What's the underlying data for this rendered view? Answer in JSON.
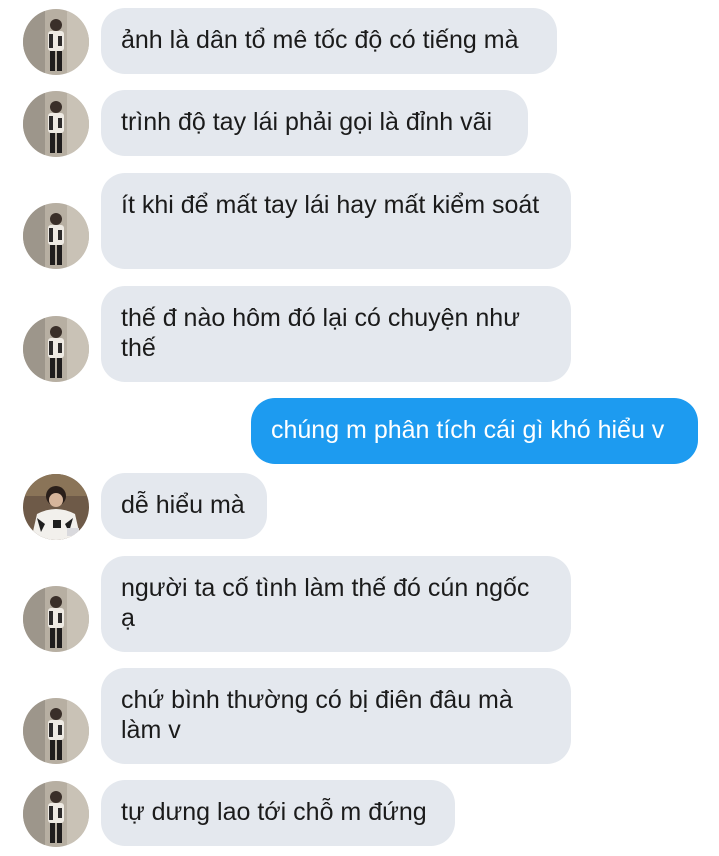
{
  "colors": {
    "incoming_bubble": "#e4e8ee",
    "outgoing_bubble": "#1d9bf0",
    "background": "#ffffff"
  },
  "messages": [
    {
      "sender": "other",
      "text": "ảnh là dân tổ mê tốc độ có tiếng mà"
    },
    {
      "sender": "other",
      "text": "trình độ tay lái phải gọi là đỉnh vãi"
    },
    {
      "sender": "other",
      "text": "ít khi để mất tay lái hay mất kiểm soát"
    },
    {
      "sender": "other",
      "text": "thế đ nào hôm đó lại có chuyện như thế"
    },
    {
      "sender": "me",
      "text": "chúng m phân tích cái gì khó hiểu v"
    },
    {
      "sender": "other2",
      "text": "dễ hiểu mà"
    },
    {
      "sender": "other",
      "text": "người ta cố tình làm thế đó cún ngốc ạ"
    },
    {
      "sender": "other",
      "text": "chứ bình thường có bị điên đâu mà làm v"
    },
    {
      "sender": "other",
      "text": "tự dưng lao tới chỗ m đứng"
    }
  ]
}
